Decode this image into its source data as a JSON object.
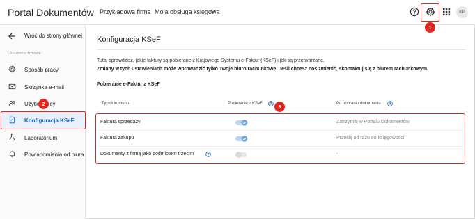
{
  "header": {
    "app_title": "Portal Dokumentów",
    "company": "Przykładowa firma",
    "accounting": "Moja obsługa księgowa",
    "avatar_initials": "KP"
  },
  "sidebar": {
    "back_label": "Wróć do strony głównej",
    "section_label": "Ustawienia firmowe",
    "items": [
      {
        "label": "Sposób pracy",
        "icon": "gear-icon"
      },
      {
        "label": "Skrzynka e-mail",
        "icon": "mail-icon"
      },
      {
        "label": "Użytkownicy",
        "icon": "users-icon"
      },
      {
        "label": "Konfiguracja KSeF",
        "icon": "document-sync-icon",
        "active": true
      },
      {
        "label": "Laboratorium",
        "icon": "flask-icon"
      },
      {
        "label": "Powiadomienia od biura",
        "icon": "bell-icon"
      }
    ]
  },
  "badges": {
    "one": "1",
    "two": "2",
    "three": "3"
  },
  "main": {
    "title": "Konfiguracja KSeF",
    "description": "Tutaj sprawdzisz, jakie faktury są pobierane z Krajowego Systemu e-Faktur (KSeF) i jak są przetwarzane.",
    "warning": "Zmiany w tych ustawieniach może wprowadzić tylko Twoje biuro rachunkowe. Jeśli chcesz coś zmienić, skontaktuj się z biurem rachunkowym.",
    "section_title": "Pobieranie e-Faktur z KSeF",
    "columns": [
      "Typ dokumentu",
      "Pobieranie z KSeF",
      "Po pobraniu dokumentu"
    ],
    "rows": [
      {
        "name": "Faktura sprzedaży",
        "download_enabled": true,
        "after": "Zatrzymaj w Portalu Dokumentów"
      },
      {
        "name": "Faktura zakupu",
        "download_enabled": true,
        "after": "Prześlij od razu do księgowości"
      },
      {
        "name": "Dokumenty z firmą jako podmiotem trzecim",
        "download_enabled": false,
        "after": "-"
      }
    ]
  },
  "colors": {
    "accent": "#1a63b8",
    "highlight": "#e0261f",
    "toggle_on": "#6fa8dc",
    "toggle_off": "#d9d9d9"
  }
}
